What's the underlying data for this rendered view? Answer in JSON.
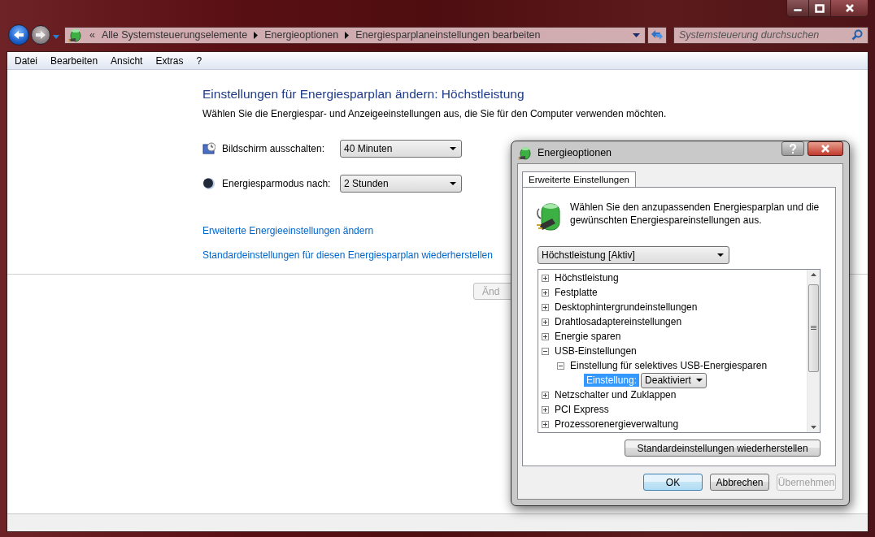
{
  "window": {
    "controls": [
      {
        "kind": "minimize"
      },
      {
        "kind": "maximize"
      },
      {
        "kind": "close"
      }
    ]
  },
  "address_bar": {
    "overflow": "«",
    "crumbs": [
      "Alle Systemsteuerungselemente",
      "Energieoptionen",
      "Energiesparplaneinstellungen bearbeiten"
    ]
  },
  "search": {
    "placeholder": "Systemsteuerung durchsuchen"
  },
  "menu": [
    "Datei",
    "Bearbeiten",
    "Ansicht",
    "Extras",
    "?"
  ],
  "main": {
    "title": "Einstellungen für Energiesparplan ändern: Höchstleistung",
    "subtitle": "Wählen Sie die Energiespar- und Anzeigeeinstellungen aus, die Sie für den Computer verwenden möchten.",
    "settings": [
      {
        "kind": "display",
        "label": "Bildschirm ausschalten:",
        "value": "40 Minuten"
      },
      {
        "kind": "sleep",
        "label": "Energiesparmodus nach:",
        "value": "2 Stunden"
      }
    ],
    "links": [
      "Erweiterte Energieeinstellungen ändern",
      "Standardeinstellungen für diesen Energiesparplan wiederherstellen"
    ],
    "button": {
      "label": "Änd",
      "disabled": true
    }
  },
  "dialog": {
    "title": "Energieoptionen",
    "tabs": [
      {
        "label": "Erweiterte Einstellungen",
        "selected": true
      }
    ],
    "description": "Wählen Sie den anzupassenden Energiesparplan und die gewünschten Energiespareinstellungen aus.",
    "plan": "Höchstleistung [Aktiv]",
    "tree": [
      {
        "label": "Höchstleistung",
        "expanded": false
      },
      {
        "label": "Festplatte",
        "expanded": false
      },
      {
        "label": "Desktophintergrundeinstellungen",
        "expanded": false
      },
      {
        "label": "Drahtlosadaptereinstellungen",
        "expanded": false
      },
      {
        "label": "Energie sparen",
        "expanded": false
      },
      {
        "label": "USB-Einstellungen",
        "expanded": true,
        "children": [
          {
            "label": "Einstellung für selektives USB-Energiesparen",
            "expanded": true,
            "children": [
              {
                "kind": "setting",
                "label": "Einstellung:",
                "value": "Deaktiviert",
                "selected": true
              }
            ]
          }
        ]
      },
      {
        "label": "Netzschalter und Zuklappen",
        "expanded": false
      },
      {
        "label": "PCI Express",
        "expanded": false
      },
      {
        "label": "Prozessorenergieverwaltung",
        "expanded": false
      }
    ],
    "restore_button": "Standardeinstellungen wiederherstellen",
    "buttons": [
      {
        "label": "OK",
        "default": true,
        "disabled": false
      },
      {
        "label": "Abbrechen",
        "default": false,
        "disabled": false
      },
      {
        "label": "Übernehmen",
        "default": false,
        "disabled": true
      }
    ]
  }
}
